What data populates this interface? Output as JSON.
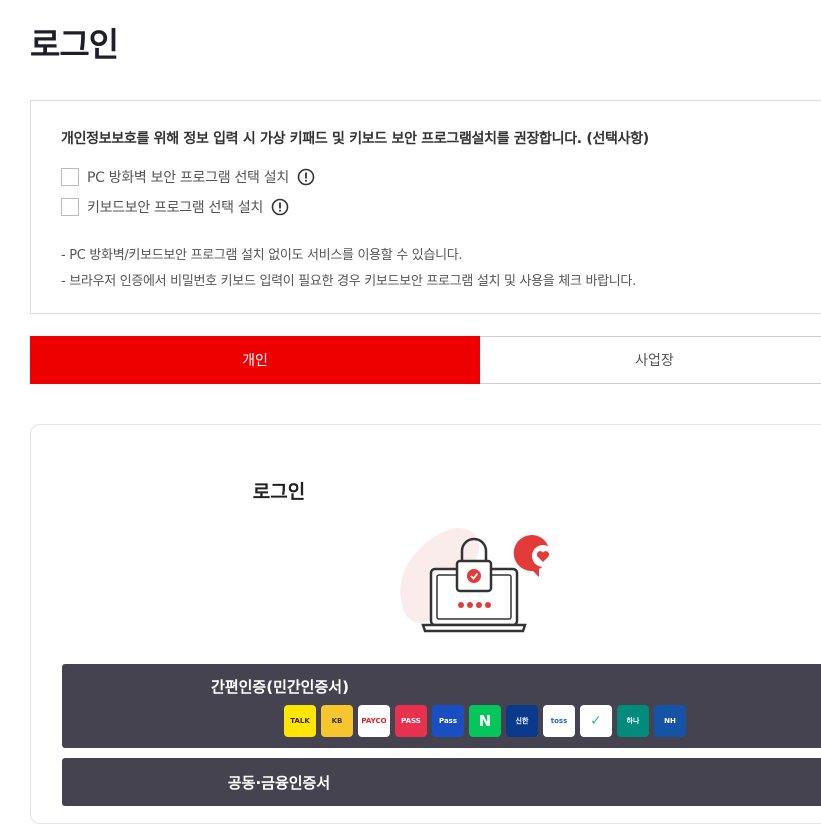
{
  "page": {
    "title": "로그인"
  },
  "notice": {
    "heading": "개인정보보호를 위해 정보 입력 시 가상 키패드 및 키보드 보안 프로그램설치를 권장합니다. (선택사항)",
    "options": [
      {
        "label": "PC 방화벽 보안 프로그램 선택 설치",
        "checked": false,
        "icon": "info-icon"
      },
      {
        "label": "키보드보안 프로그램 선택 설치",
        "checked": false,
        "icon": "info-icon"
      }
    ],
    "notes": [
      "- PC 방화벽/키보드보안 프로그램 설치 없이도 서비스를 이용할 수 있습니다.",
      "- 브라우저 인증에서 비밀번호 키보드 입력이 필요한 경우 키보드보안 프로그램 설치 및 사용을 체크 바랍니다."
    ]
  },
  "tabs": [
    {
      "label": "개인",
      "active": true
    },
    {
      "label": "사업장",
      "active": false
    }
  ],
  "login": {
    "heading": "로그인",
    "simple_auth": {
      "label": "간편인증(민간인증서)",
      "providers": [
        {
          "name": "kakao",
          "text": "TALK",
          "bg": "#ffe600",
          "fg": "#3c1e1e"
        },
        {
          "name": "kb",
          "text": "KB",
          "bg": "#f7c52d",
          "fg": "#333333"
        },
        {
          "name": "payco",
          "text": "PAYCO",
          "bg": "#ffffff",
          "fg": "#e41e26"
        },
        {
          "name": "pass",
          "text": "PASS",
          "bg": "#e8314f",
          "fg": "#ffffff"
        },
        {
          "name": "samsung-pass",
          "text": "Pass",
          "bg": "#1a4fc4",
          "fg": "#ffffff"
        },
        {
          "name": "naver",
          "text": "N",
          "bg": "#03c75a",
          "fg": "#ffffff"
        },
        {
          "name": "shinhan",
          "text": "신한",
          "bg": "#0a3a8c",
          "fg": "#ffffff"
        },
        {
          "name": "toss",
          "text": "toss",
          "bg": "#ffffff",
          "fg": "#1b64da"
        },
        {
          "name": "banksalad",
          "text": "✓",
          "bg": "#ffffff",
          "fg": "#2fb39a"
        },
        {
          "name": "hana",
          "text": "하나",
          "bg": "#008b7d",
          "fg": "#ffffff"
        },
        {
          "name": "nh",
          "text": "NH",
          "bg": "#1453a6",
          "fg": "#ffffff"
        }
      ]
    },
    "public_cert": {
      "label": "공동·금융인증서"
    }
  },
  "colors": {
    "accent": "#ee0000",
    "button_dark": "#44434f"
  }
}
